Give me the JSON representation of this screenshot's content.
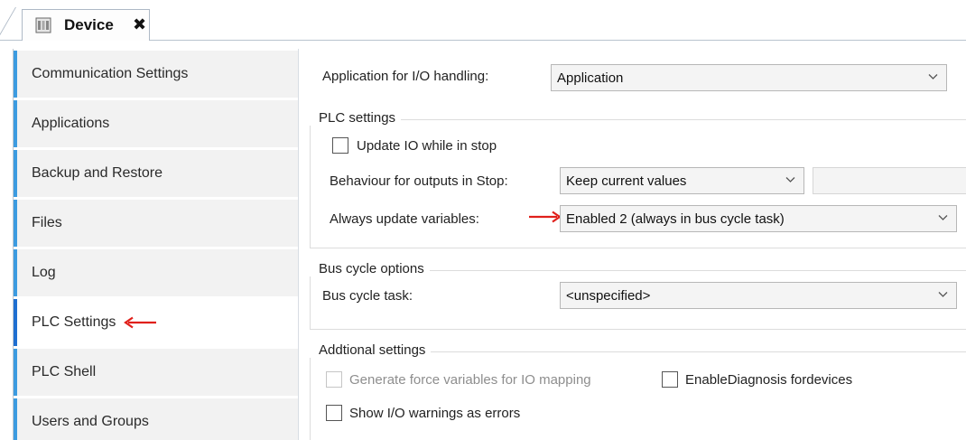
{
  "editor_tab": {
    "label": "Device",
    "close_label": "✖",
    "icon": "device-icon"
  },
  "sidebar": {
    "items": [
      {
        "label": "Communication Settings"
      },
      {
        "label": "Applications"
      },
      {
        "label": "Backup and Restore"
      },
      {
        "label": "Files"
      },
      {
        "label": "Log"
      },
      {
        "label": "PLC Settings",
        "active": true
      },
      {
        "label": "PLC Shell"
      },
      {
        "label": "Users and Groups"
      }
    ]
  },
  "main": {
    "io_handling": {
      "label": "Application for I/O handling:",
      "value": "Application"
    },
    "plc_settings": {
      "title": "PLC settings",
      "update_io": {
        "label": "Update IO while in stop",
        "checked": false
      },
      "outputs_stop": {
        "label": "Behaviour for outputs in Stop:",
        "value": "Keep current values"
      },
      "always_update": {
        "label": "Always update variables:",
        "value": "Enabled 2 (always in bus cycle task)"
      }
    },
    "bus_cycle": {
      "title": "Bus cycle options",
      "task": {
        "label": "Bus cycle task:",
        "value": "<unspecified>"
      }
    },
    "additional": {
      "title": "Addtional settings",
      "force_vars": {
        "label": "Generate force variables for IO mapping",
        "checked": false,
        "disabled": true
      },
      "diagnosis": {
        "label": "EnableDiagnosis fordevices",
        "checked": false
      },
      "io_warnings": {
        "label": "Show I/O warnings as errors",
        "checked": false
      }
    }
  },
  "colors": {
    "annotation_arrow": "#e0201b",
    "sidebar_accent": "#3c9be0",
    "sidebar_active_accent": "#1f6fd1"
  }
}
